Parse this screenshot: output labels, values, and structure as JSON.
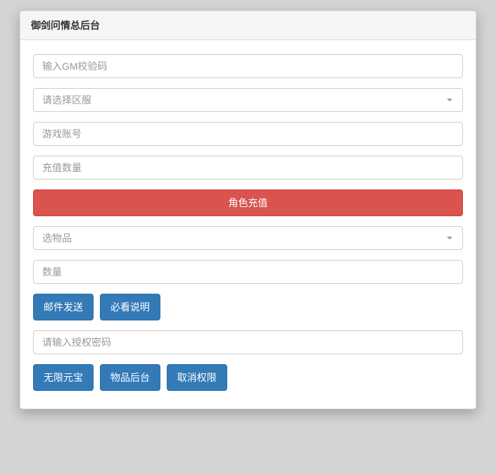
{
  "panel": {
    "title": "御剑问情总后台"
  },
  "inputs": {
    "gm_code_placeholder": "输入GM校验码",
    "server_select_label": "请选择区服",
    "account_placeholder": "游戏账号",
    "recharge_amount_placeholder": "充值数量",
    "item_select_label": "选物品",
    "quantity_placeholder": "数量",
    "auth_password_placeholder": "请输入授权密码"
  },
  "buttons": {
    "role_recharge": "角色充值",
    "mail_send": "邮件发送",
    "must_read": "必看说明",
    "unlimited_yuanbao": "无限元宝",
    "item_backend": "物品后台",
    "cancel_auth": "取消权限"
  }
}
